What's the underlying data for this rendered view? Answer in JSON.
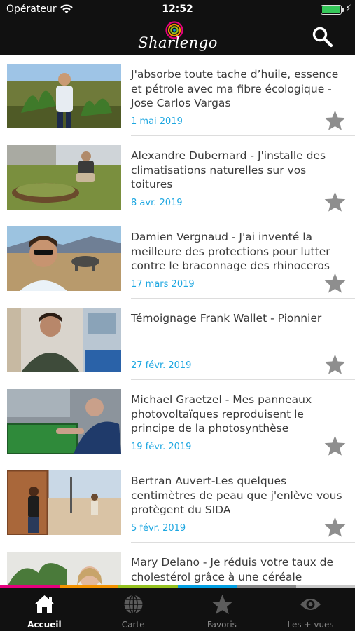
{
  "status_bar": {
    "carrier": "Opérateur",
    "time": "12:52",
    "battery_color": "#35c759"
  },
  "header": {
    "logo_text": "Sharlengo",
    "search_icon": "search-icon"
  },
  "articles": [
    {
      "title": "J'absorbe toute tache d’huile, essence et pétrole avec ma fibre écologique - Jose Carlos Vargas",
      "date": "1 mai 2019",
      "favorite_icon": "star-icon"
    },
    {
      "title": "Alexandre Dubernard - J'installe des climatisations naturelles sur vos toitures",
      "date": "8 avr. 2019",
      "favorite_icon": "star-icon"
    },
    {
      "title": "Damien Vergnaud - J'ai inventé la meilleure des protections pour lutter contre le braconnage des rhinoceros",
      "date": "17 mars 2019",
      "favorite_icon": "star-icon"
    },
    {
      "title": "Témoignage Frank Wallet - Pionnier",
      "date": "27 févr. 2019",
      "favorite_icon": "star-icon"
    },
    {
      "title": "Michael Graetzel - Mes panneaux photovoltaïques reproduisent le principe de la photosynthèse",
      "date": "19 févr. 2019",
      "favorite_icon": "star-icon"
    },
    {
      "title": "Bertran Auvert-Les quelques centimètres de peau que j'enlève vous protègent du SIDA",
      "date": "5 févr. 2019",
      "favorite_icon": "star-icon"
    },
    {
      "title": "Mary Delano - Je réduis votre taux de cholestérol grâce à une céréale",
      "date": "",
      "favorite_icon": "star-icon"
    }
  ],
  "tabs": [
    {
      "label": "Accueil",
      "icon": "home-icon",
      "active": true
    },
    {
      "label": "Carte",
      "icon": "globe-icon",
      "active": false
    },
    {
      "label": "Favoris",
      "icon": "star-icon",
      "active": false
    },
    {
      "label": "Les + vues",
      "icon": "eye-icon",
      "active": false
    }
  ],
  "colors": {
    "date": "#1ea7e1",
    "bar_background": "#111111",
    "strip": [
      "#e5007e",
      "#f39200",
      "#95c11f",
      "#009fe3",
      "#8a8a8a",
      "#c8c8c8"
    ]
  }
}
